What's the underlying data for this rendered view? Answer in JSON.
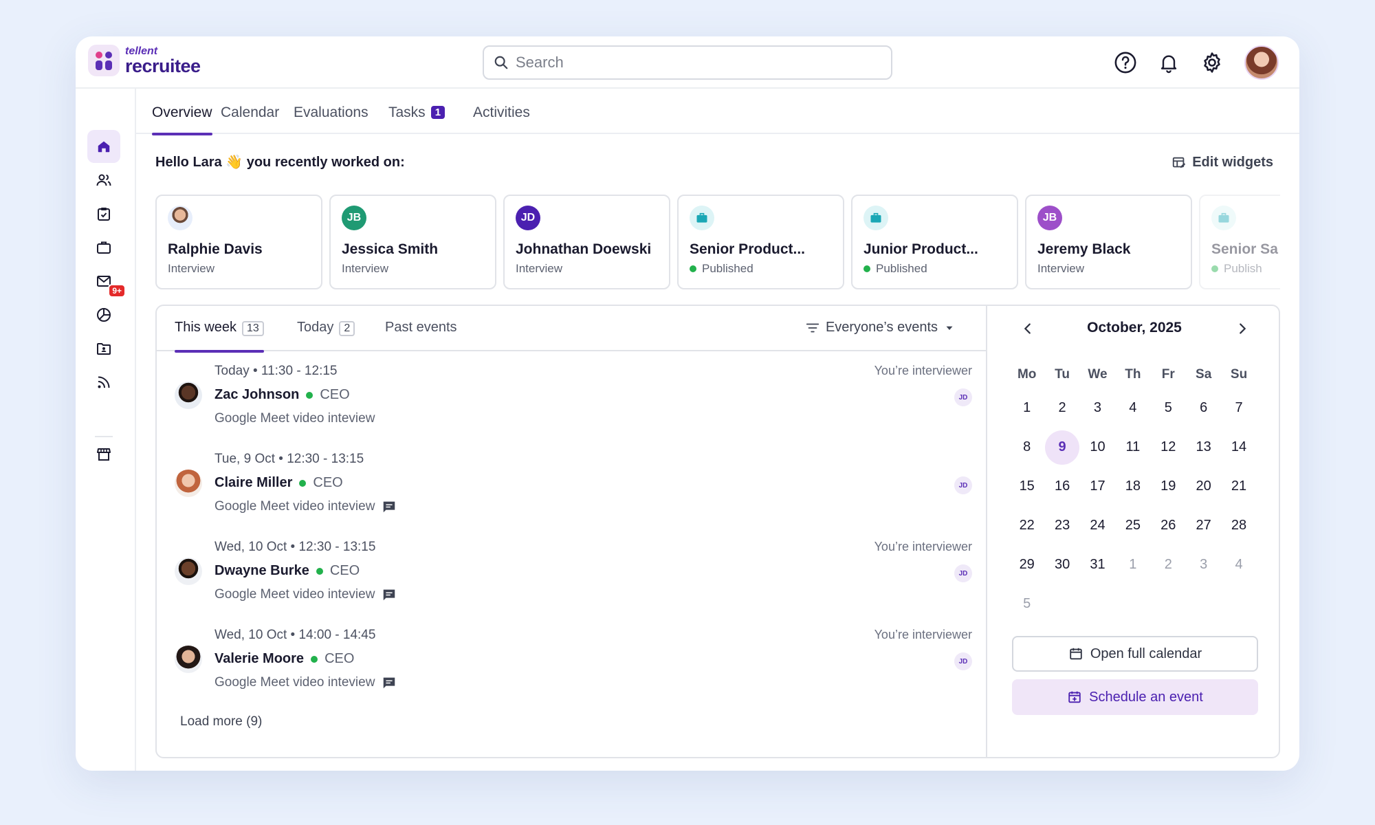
{
  "brand": {
    "small": "tellent",
    "big": "recruitee"
  },
  "search": {
    "placeholder": "Search"
  },
  "sidebar": {
    "mail_badge": "9+"
  },
  "tabs": [
    {
      "label": "Overview"
    },
    {
      "label": "Calendar"
    },
    {
      "label": "Evaluations"
    },
    {
      "label": "Tasks",
      "count": "1"
    },
    {
      "label": "Activities"
    }
  ],
  "greeting": "Hello Lara 👋 you recently worked on:",
  "edit_widgets": "Edit widgets",
  "recent": [
    {
      "name": "Ralphie Davis",
      "status": "Interview"
    },
    {
      "initials": "JB",
      "color": "#1f9a73",
      "name": "Jessica Smith",
      "status": "Interview"
    },
    {
      "initials": "JD",
      "color": "#4b20b0",
      "name": "Johnathan Doewski",
      "status": "Interview"
    },
    {
      "name": "Senior Product...",
      "status": "Published"
    },
    {
      "name": "Junior Product...",
      "status": "Published"
    },
    {
      "initials": "JB",
      "color": "#9d4fc9",
      "name": "Jeremy Black",
      "status": "Interview"
    },
    {
      "name": "Senior Sa",
      "status": "Publish"
    }
  ],
  "event_tabs": [
    {
      "label": "This week",
      "count": "13"
    },
    {
      "label": "Today",
      "count": "2"
    },
    {
      "label": "Past events"
    }
  ],
  "filter": "Everyone’s events",
  "events": [
    {
      "when": "Today • 11:30 - 12:15",
      "name": "Zac Johnson",
      "role": "CEO",
      "desc": "Google Meet video inteview",
      "note": "You’re interviewer",
      "badge": "JD"
    },
    {
      "when": "Tue, 9 Oct • 12:30 - 13:15",
      "name": "Claire Miller",
      "role": "CEO",
      "desc": "Google Meet video inteview",
      "note": "",
      "badge": "JD"
    },
    {
      "when": "Wed, 10 Oct • 12:30 - 13:15",
      "name": "Dwayne Burke",
      "role": "CEO",
      "desc": "Google Meet video inteview",
      "note": "You’re interviewer",
      "badge": "JD"
    },
    {
      "when": "Wed, 10 Oct • 14:00 - 14:45",
      "name": "Valerie Moore",
      "role": "CEO",
      "desc": "Google Meet video inteview",
      "note": "You’re interviewer",
      "badge": "JD"
    }
  ],
  "load_more": "Load more (9)",
  "calendar": {
    "title": "October, 2025",
    "weekdays": [
      "Mo",
      "Tu",
      "We",
      "Th",
      "Fr",
      "Sa",
      "Su"
    ],
    "days": [
      "1",
      "2",
      "3",
      "4",
      "5",
      "6",
      "7",
      "8",
      "9",
      "10",
      "11",
      "12",
      "13",
      "14",
      "15",
      "16",
      "17",
      "18",
      "19",
      "20",
      "21",
      "22",
      "23",
      "24",
      "25",
      "26",
      "27",
      "28",
      "29",
      "30",
      "31",
      "1",
      "2",
      "3",
      "4",
      "5"
    ],
    "today": "9",
    "open_full": "Open full calendar",
    "schedule": "Schedule an event"
  }
}
